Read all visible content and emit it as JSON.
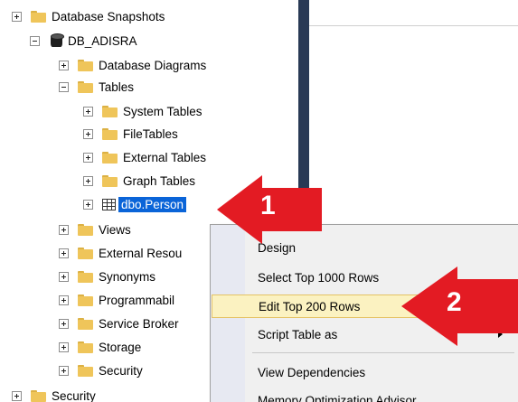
{
  "tree": {
    "database_snapshots": "Database Snapshots",
    "db_name": "DB_ADISRA",
    "database_diagrams": "Database Diagrams",
    "tables": "Tables",
    "system_tables": "System Tables",
    "file_tables": "FileTables",
    "external_tables": "External Tables",
    "graph_tables": "Graph Tables",
    "selected_table": "dbo.Person",
    "views": "Views",
    "external_resources": "External Resou",
    "synonyms": "Synonyms",
    "programmability": "Programmabil",
    "service_broker": "Service Broker",
    "storage": "Storage",
    "security_db": "Security",
    "security_root": "Security"
  },
  "context_menu": {
    "design": "Design",
    "select_top": "Select Top 1000 Rows",
    "edit_top": "Edit Top 200 Rows",
    "script_table_as": "Script Table as",
    "view_dependencies": "View Dependencies",
    "memory_optimization": "Memory Optimization Advisor"
  },
  "callouts": {
    "step1": "1",
    "step2": "2"
  },
  "colors": {
    "selection": "#0a64d8",
    "highlight": "#fbf2c1",
    "callout_red": "#e31b23",
    "splitter": "#293955"
  }
}
